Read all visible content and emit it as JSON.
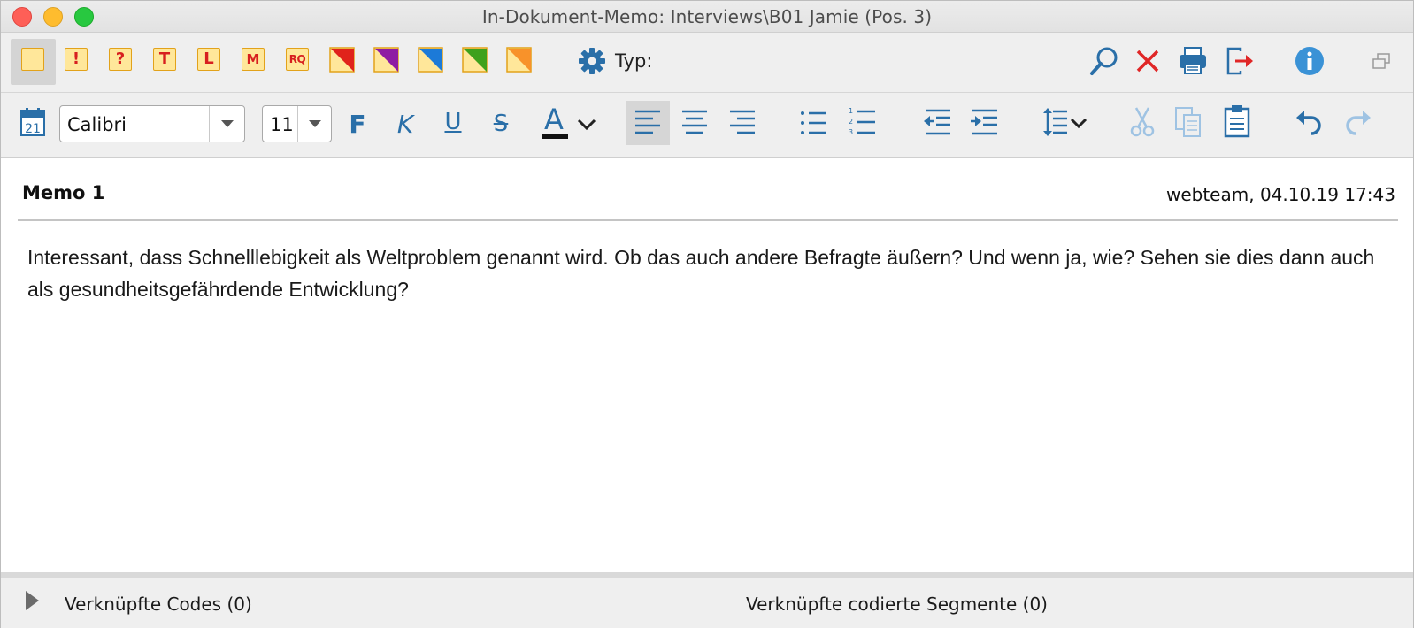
{
  "window": {
    "title": "In-Dokument-Memo: Interviews\\B01 Jamie (Pos. 3)"
  },
  "memo_types": [
    {
      "name": "memo-standard-icon",
      "label": ""
    },
    {
      "name": "memo-exclamation-icon",
      "label": "!"
    },
    {
      "name": "memo-question-icon",
      "label": "?"
    },
    {
      "name": "memo-t-icon",
      "label": "T"
    },
    {
      "name": "memo-l-icon",
      "label": "L"
    },
    {
      "name": "memo-m-icon",
      "label": "M"
    },
    {
      "name": "memo-rq-icon",
      "label": "RQ"
    }
  ],
  "memo_color_types": [
    {
      "name": "memo-red-icon",
      "color": "#e0231b"
    },
    {
      "name": "memo-purple-icon",
      "color": "#8e1ba3"
    },
    {
      "name": "memo-blue-icon",
      "color": "#1c7ad8"
    },
    {
      "name": "memo-green-icon",
      "color": "#3ea11d"
    },
    {
      "name": "memo-orange-icon",
      "color": "#f8922a"
    }
  ],
  "toolbar": {
    "type_label": "Typ:"
  },
  "format": {
    "font_name": "Calibri",
    "font_size": "11",
    "bold_label": "F",
    "italic_label": "K",
    "underline_label": "U",
    "strike_label": "S",
    "color_label": "A",
    "calendar_day": "21"
  },
  "memo": {
    "title": "Memo 1",
    "meta": "webteam, 04.10.19 17:43",
    "body": "Interessant, dass Schnelllebigkeit als Weltproblem genannt wird. Ob das auch andere Befragte äußern? Und wenn ja, wie? Sehen sie dies dann auch als gesundheitsgefährdende Entwicklung?"
  },
  "footer": {
    "linked_codes": "Verknüpfte Codes (0)",
    "linked_segments": "Verknüpfte codierte Segmente (0)"
  },
  "colors": {
    "accent_blue": "#2a6fa8",
    "close_red": "#e02626"
  }
}
